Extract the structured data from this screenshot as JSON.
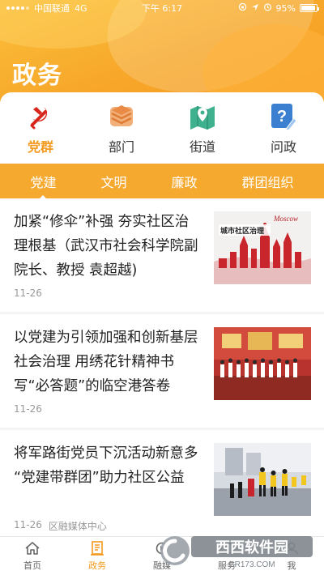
{
  "status_bar": {
    "carrier": "中国联通",
    "network": "4G",
    "time": "下午 6:17",
    "battery": "95%",
    "battery_level": 0.95
  },
  "page_title": "政务",
  "categories": [
    {
      "label": "党群",
      "icon": "party-emblem-icon",
      "active": true
    },
    {
      "label": "部门",
      "icon": "stack-layers-icon",
      "active": false
    },
    {
      "label": "街道",
      "icon": "map-pin-icon",
      "active": false
    },
    {
      "label": "问政",
      "icon": "question-edit-icon",
      "active": false
    }
  ],
  "tabs": [
    {
      "label": "党建",
      "active": true
    },
    {
      "label": "文明",
      "active": false
    },
    {
      "label": "廉政",
      "active": false
    },
    {
      "label": "群团组织",
      "active": false
    }
  ],
  "articles": [
    {
      "title": "加紧“修伞”补强 夯实社区治理根基（武汉市社会科学院副院长、教授 袁超越)",
      "date": "11-26",
      "source": "",
      "thumb_caption": "城市社区治理",
      "thumb_script": "Moscow"
    },
    {
      "title": "以党建为引领加强和创新基层社会治理 用绣花针精神书写“必答题”的临空港答卷",
      "date": "11-26",
      "source": ""
    },
    {
      "title": "将军路街党员下沉活动新意多 “党建带群团”助力社区公益",
      "date": "11-26",
      "source": "区融媒体中心"
    }
  ],
  "bottom_nav": [
    {
      "label": "首页",
      "icon": "home-icon",
      "active": false
    },
    {
      "label": "政务",
      "icon": "document-icon",
      "active": true
    },
    {
      "label": "融媒",
      "icon": "media-icon",
      "active": false
    },
    {
      "label": "服务",
      "icon": "service-icon",
      "active": false
    },
    {
      "label": "我",
      "icon": "user-icon",
      "active": false
    }
  ],
  "watermark": {
    "text": "西西软件园",
    "sub": "CR173.COM"
  },
  "colors": {
    "accent": "#f39a1e",
    "tab_bar": "#f6a92f",
    "party_red": "#d9261c"
  }
}
